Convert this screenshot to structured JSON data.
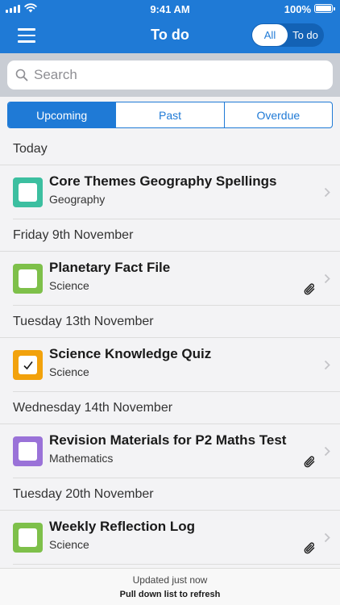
{
  "status_bar": {
    "time": "9:41 AM",
    "battery": "100%"
  },
  "nav": {
    "title": "To do",
    "filter_options": [
      "All",
      "To do"
    ],
    "filter_selected": "All"
  },
  "search": {
    "placeholder": "Search"
  },
  "tabs": [
    {
      "label": "Upcoming",
      "active": true
    },
    {
      "label": "Past",
      "active": false
    },
    {
      "label": "Overdue",
      "active": false
    }
  ],
  "sections": [
    {
      "header": "Today",
      "items": [
        {
          "title": "Core Themes Geography Spellings",
          "subject": "Geography",
          "color": "#3cbfa0",
          "checked": false,
          "attachment": false
        }
      ]
    },
    {
      "header": "Friday 9th November",
      "items": [
        {
          "title": "Planetary Fact File",
          "subject": "Science",
          "color": "#7ec04a",
          "checked": false,
          "attachment": true
        }
      ]
    },
    {
      "header": "Tuesday 13th November",
      "items": [
        {
          "title": "Science Knowledge Quiz",
          "subject": "Science",
          "color": "#f2a20c",
          "checked": true,
          "attachment": false
        }
      ]
    },
    {
      "header": "Wednesday 14th November",
      "items": [
        {
          "title": "Revision Materials for P2 Maths Test",
          "subject": "Mathematics",
          "color": "#9a72d8",
          "checked": false,
          "attachment": true
        }
      ]
    },
    {
      "header": "Tuesday 20th November",
      "items": [
        {
          "title": "Weekly Reflection Log",
          "subject": "Science",
          "color": "#7ec04a",
          "checked": false,
          "attachment": true
        }
      ]
    }
  ],
  "footer": {
    "updated": "Updated just now",
    "pull_hint": "Pull down list to refresh"
  }
}
